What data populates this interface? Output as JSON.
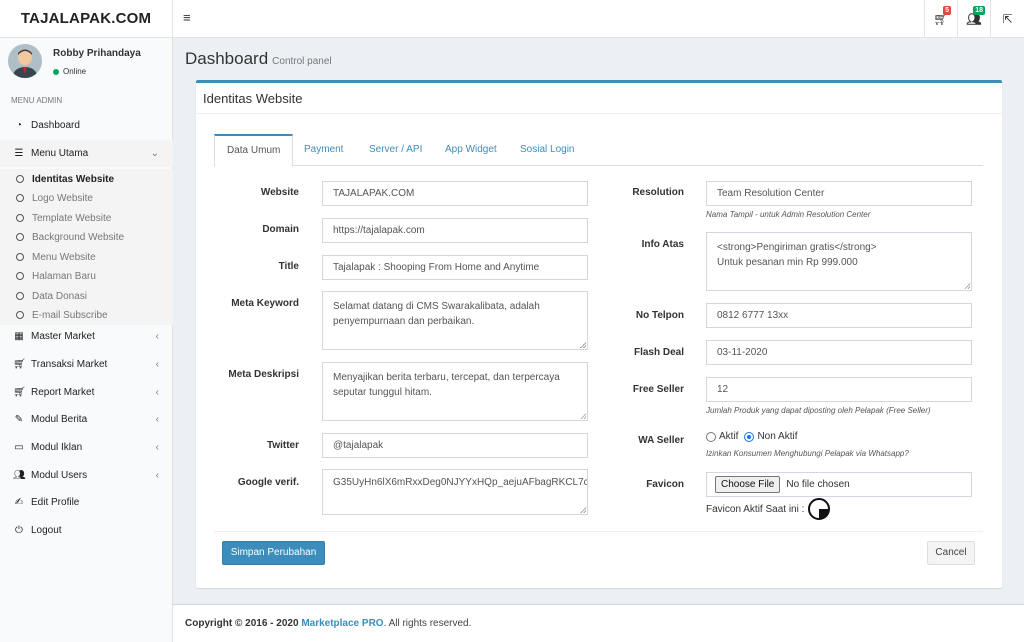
{
  "header": {
    "logo": "TAJALAPAK.COM",
    "cart_badge": "5",
    "users_badge": "18",
    "badge_colors": {
      "cart": "#dd4b39",
      "users": "#00a65a"
    }
  },
  "user": {
    "name": "Robby Prihandaya",
    "status": "Online"
  },
  "sidebar": {
    "menu_header": "MENU ADMIN",
    "dashboard": "Dashboard",
    "menu_utama": "Menu Utama",
    "sub_items": [
      "Identitas Website",
      "Logo Website",
      "Template Website",
      "Background Website",
      "Menu Website",
      "Halaman Baru",
      "Data Donasi",
      "E-mail Subscribe"
    ],
    "items": [
      "Master Market",
      "Transaksi Market",
      "Report Market",
      "Modul Berita",
      "Modul Iklan",
      "Modul Users",
      "Edit Profile",
      "Logout"
    ]
  },
  "content": {
    "title": "Dashboard",
    "subtitle": "Control panel"
  },
  "box": {
    "title": "Identitas Website"
  },
  "tabs": [
    "Data Umum",
    "Payment",
    "Server / API",
    "App Widget",
    "Sosial Login"
  ],
  "form": {
    "website_label": "Website",
    "website": "TAJALAPAK.COM",
    "domain_label": "Domain",
    "domain": "https://tajalapak.com",
    "title_label": "Title",
    "title": "Tajalapak : Shooping From Home and Anytime",
    "meta_keyword_label": "Meta Keyword",
    "meta_keyword": "Selamat datang di CMS Swarakalibata, adalah penyempurnaan dan perbaikan.",
    "meta_deskripsi_label": "Meta Deskripsi",
    "meta_deskripsi": "Menyajikan berita terbaru, tercepat, dan terpercaya seputar tunggul hitam.",
    "twitter_label": "Twitter",
    "twitter": "@tajalapak",
    "google_label": "Google verif.",
    "google": "G35UyHn6lX6mRxxDeg0NJYYxHQp_aejuAFbagRKCL7c",
    "resolution_label": "Resolution",
    "resolution": "Team Resolution Center",
    "resolution_help": "Nama Tampil - untuk Admin Resolution Center",
    "info_atas_label": "Info Atas",
    "info_atas_1": "<strong>Pengiriman gratis</strong>",
    "info_atas_2": "Untuk pesanan min Rp 999.000",
    "telpon_label": "No Telpon",
    "telpon": "0812 6777 13xx",
    "flash_label": "Flash Deal",
    "flash": "03-11-2020",
    "free_label": "Free Seller",
    "free": "12",
    "free_help": "Jumlah Produk yang dapat diposting oleh Pelapak (Free Seller)",
    "wa_label": "WA Seller",
    "wa_opt1": "Aktif",
    "wa_opt2": "Non Aktif",
    "wa_selected": "Non Aktif",
    "wa_help": "Izinkan Konsumen Menghubungi Pelapak via Whatsapp?",
    "favicon_label": "Favicon",
    "file_btn": "Choose File",
    "file_none": "No file chosen",
    "favicon_current": "Favicon Aktif Saat ini :"
  },
  "buttons": {
    "save": "Simpan Perubahan",
    "cancel": "Cancel"
  },
  "footer": {
    "copyright": "Copyright © 2016 - 2020",
    "brand": "Marketplace PRO",
    "rights": ". All rights reserved."
  }
}
